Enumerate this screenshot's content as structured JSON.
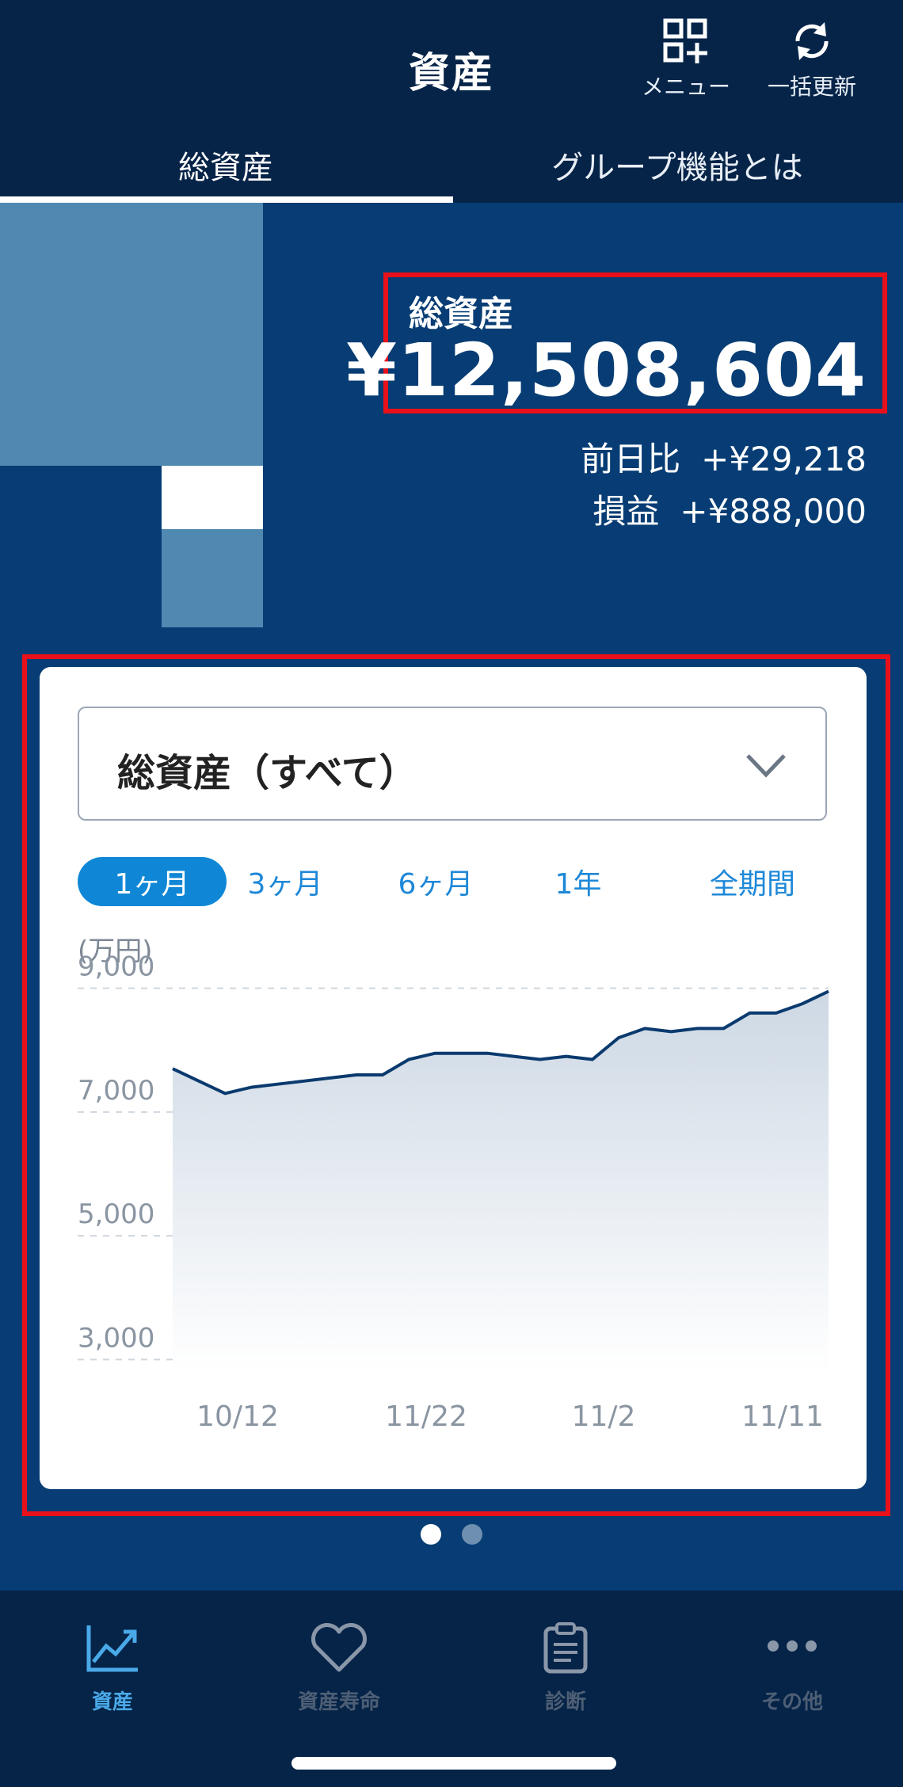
{
  "header": {
    "title": "資産",
    "menu_label": "メニュー",
    "refresh_label": "一括更新"
  },
  "tabs": [
    {
      "label": "総資産",
      "active": true
    },
    {
      "label": "グループ機能とは",
      "active": false
    }
  ],
  "summary": {
    "label": "総資産",
    "total": "¥12,508,604",
    "day_change_label": "前日比",
    "day_change_value": "+¥29,218",
    "pnl_label": "損益",
    "pnl_value": "+¥888,000"
  },
  "selector": {
    "value": "総資産（すべて）"
  },
  "periods": [
    {
      "label": "1ヶ月",
      "active": true
    },
    {
      "label": "3ヶ月",
      "active": false
    },
    {
      "label": "6ヶ月",
      "active": false
    },
    {
      "label": "1年",
      "active": false
    },
    {
      "label": "全期間",
      "active": false
    }
  ],
  "chart_data": {
    "type": "area",
    "unit_label": "(万円)",
    "ylim": [
      2800,
      9200
    ],
    "yticks": [
      3000,
      5000,
      7000,
      9000
    ],
    "ytick_labels": [
      "3,000",
      "5,000",
      "7,000",
      "9,000"
    ],
    "xtick_labels": [
      "10/12",
      "11/22",
      "11/2",
      "11/11"
    ],
    "grid": true,
    "series": [
      {
        "values": [
          7700,
          7500,
          7300,
          7400,
          7450,
          7500,
          7550,
          7600,
          7600,
          7850,
          7950,
          7950,
          7950,
          7900,
          7850,
          7900,
          7850,
          8200,
          8350,
          8300,
          8350,
          8350,
          8600,
          8600,
          8750,
          8950
        ]
      }
    ],
    "colors": {
      "line": "#0a3a6e",
      "fill_top": "#cdd8e4",
      "grid": "#cfd6de"
    }
  },
  "pager": {
    "pages": 2,
    "current": 0
  },
  "bottom_nav": [
    {
      "label": "資産",
      "icon": "chart-line-icon",
      "active": true
    },
    {
      "label": "資産寿命",
      "icon": "heart-icon",
      "active": false
    },
    {
      "label": "診断",
      "icon": "clipboard-icon",
      "active": false
    },
    {
      "label": "その他",
      "icon": "more-icon",
      "active": false
    }
  ],
  "colors": {
    "brand": "#073d74",
    "header": "#062448",
    "accent": "#0f87d6",
    "highlight": "#e8101a"
  }
}
